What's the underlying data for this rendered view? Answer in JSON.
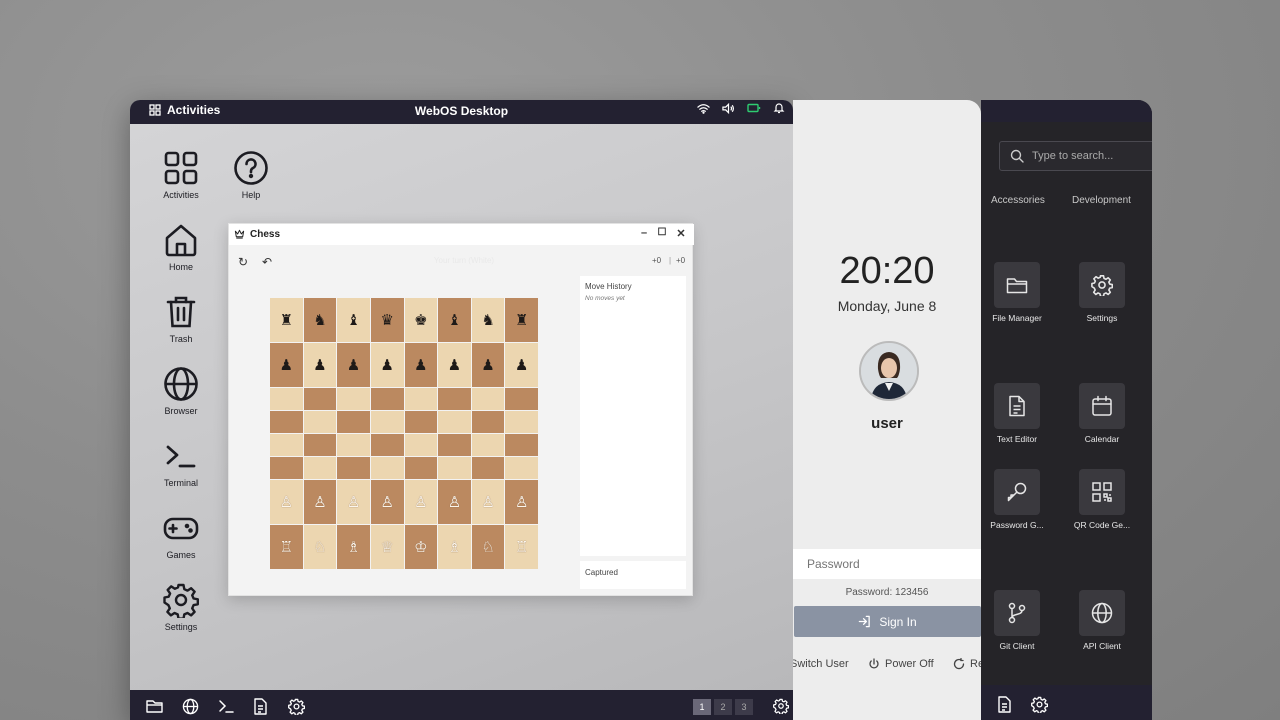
{
  "topbar": {
    "activities_label": "Activities",
    "title": "WebOS Desktop"
  },
  "desktop_icons": [
    {
      "label": "Activities",
      "icon": "grid-icon"
    },
    {
      "label": "Help",
      "icon": "help-icon"
    },
    {
      "label": "Home",
      "icon": "home-icon"
    },
    {
      "label": "Trash",
      "icon": "trash-icon"
    },
    {
      "label": "Browser",
      "icon": "globe-icon"
    },
    {
      "label": "Terminal",
      "icon": "terminal-icon"
    },
    {
      "label": "Games",
      "icon": "gamepad-icon"
    },
    {
      "label": "Settings",
      "icon": "gear-icon"
    }
  ],
  "chess": {
    "title": "Chess",
    "status": "Your turn (White)",
    "score_white": "+0",
    "score_black": "+0",
    "move_history_title": "Move History",
    "move_history_empty": "No moves yet",
    "captured_title": "Captured",
    "board": [
      [
        "♜",
        "♞",
        "♝",
        "♛",
        "♚",
        "♝",
        "♞",
        "♜"
      ],
      [
        "♟",
        "♟",
        "♟",
        "♟",
        "♟",
        "♟",
        "♟",
        "♟"
      ],
      [
        "",
        "",
        "",
        "",
        "",
        "",
        "",
        ""
      ],
      [
        "",
        "",
        "",
        "",
        "",
        "",
        "",
        ""
      ],
      [
        "",
        "",
        "",
        "",
        "",
        "",
        "",
        ""
      ],
      [
        "",
        "",
        "",
        "",
        "",
        "",
        "",
        ""
      ],
      [
        "♙",
        "♙",
        "♙",
        "♙",
        "♙",
        "♙",
        "♙",
        "♙"
      ],
      [
        "♖",
        "♘",
        "♗",
        "♕",
        "♔",
        "♗",
        "♘",
        "♖"
      ]
    ]
  },
  "taskbar": {
    "workspaces": [
      "1",
      "2",
      "3"
    ],
    "active_workspace": "1"
  },
  "login": {
    "time": "20:20",
    "date": "Monday, June 8",
    "username": "user",
    "password_placeholder": "Password",
    "password_hint": "Password: 123456",
    "sign_in_label": "Sign In",
    "switch_user_label": "Switch User",
    "power_off_label": "Power Off",
    "restart_label": "Re"
  },
  "launcher": {
    "search_placeholder": "Type to search...",
    "categories": [
      "Accessories",
      "Development"
    ],
    "apps": [
      {
        "label": "File Manager",
        "icon": "folder-icon"
      },
      {
        "label": "Settings",
        "icon": "gear-icon"
      },
      {
        "label": "Text Editor",
        "icon": "document-icon"
      },
      {
        "label": "Calendar",
        "icon": "calendar-icon"
      },
      {
        "label": "Password G...",
        "icon": "key-icon"
      },
      {
        "label": "QR Code Ge...",
        "icon": "qr-icon"
      },
      {
        "label": "Git Client",
        "icon": "git-branch-icon"
      },
      {
        "label": "API Client",
        "icon": "globe-icon"
      }
    ]
  },
  "colors": {
    "topbar": "#232131",
    "board_light": "#ecd6b0",
    "board_dark": "#bb8960",
    "signin": "#8a93a3",
    "launcher_bg": "#252428"
  }
}
